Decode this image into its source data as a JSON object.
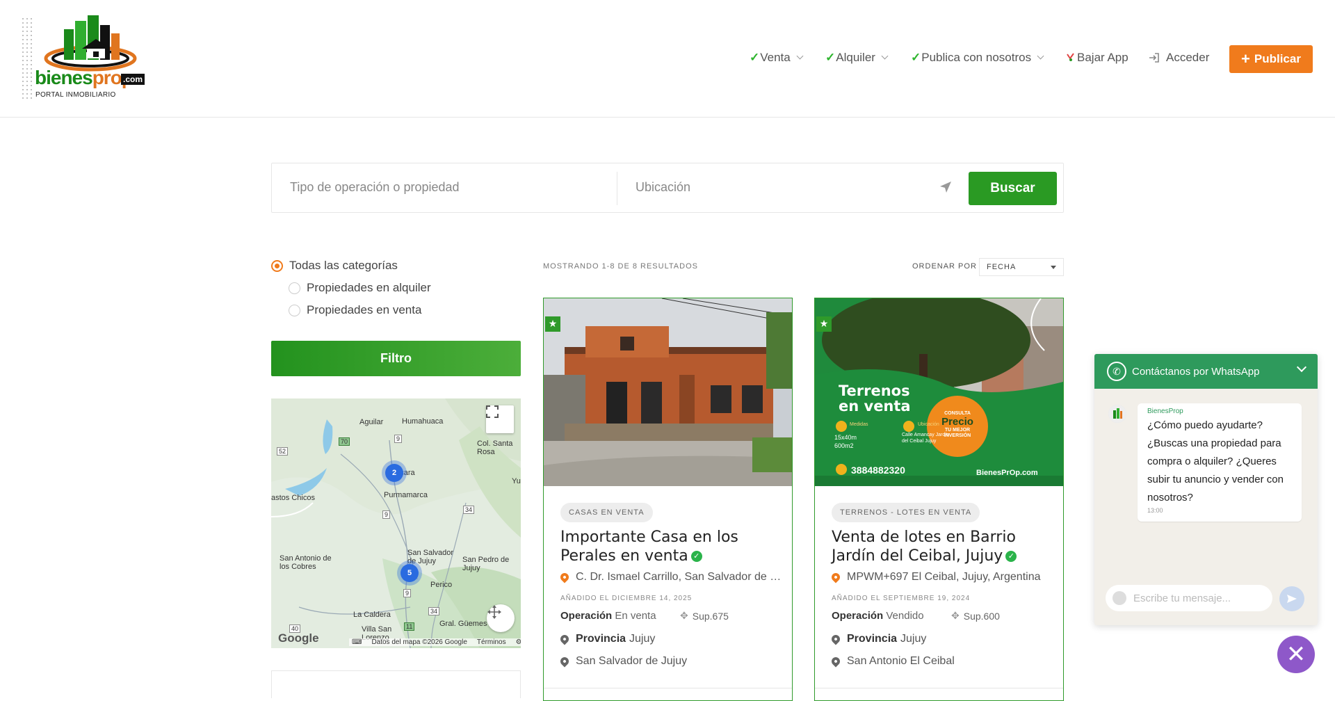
{
  "brand": {
    "name_part1": "bienes",
    "name_part2": "prop",
    "suffix": ".com",
    "tagline": "PORTAL INMOBILIARIO"
  },
  "nav": {
    "items": [
      {
        "label": "Venta",
        "check": "✓",
        "has_dropdown": true
      },
      {
        "label": "Alquiler",
        "check": "✓",
        "has_dropdown": true
      },
      {
        "label": "Publica con nosotros",
        "check": "✓",
        "has_dropdown": true
      },
      {
        "label": "Bajar App",
        "icon": "app-download-icon"
      },
      {
        "label": "Acceder",
        "icon": "login-icon"
      }
    ],
    "publish_label": "Publicar"
  },
  "search": {
    "operation_placeholder": "Tipo de operación o propiedad",
    "location_placeholder": "Ubicación",
    "button_label": "Buscar"
  },
  "filters": {
    "categories": [
      {
        "label": "Todas las categorías",
        "selected": true
      },
      {
        "label": "Propiedades en alquiler",
        "selected": false
      },
      {
        "label": "Propiedades en venta",
        "selected": false
      }
    ],
    "button_label": "Filtro"
  },
  "map": {
    "labels": [
      "Aguilar",
      "Humahuaca",
      "Col. Santa Rosa",
      "Tilcara",
      "Purmamarca",
      "astos Chicos",
      "San Antonio de los Cobres",
      "San Salvador de Jujuy",
      "San Pedro de Jujuy",
      "Perico",
      "La Caldera",
      "Gral. Güemes",
      "Villa San Lorenzo",
      "Yu"
    ],
    "road_numbers": [
      "52",
      "70",
      "9",
      "9",
      "34",
      "9",
      "34",
      "40",
      "11"
    ],
    "clusters": [
      {
        "count": "2"
      },
      {
        "count": "5"
      }
    ],
    "logo": "Google",
    "attribution": "Datos del mapa ©2026 Google",
    "terms": "Términos"
  },
  "results": {
    "summary": "MOSTRANDO 1-8 DE 8 RESULTADOS",
    "sort_label": "ORDENAR POR",
    "sort_value": "FECHA"
  },
  "listings": [
    {
      "category": "CASAS EN VENTA",
      "title": "Importante Casa en los Perales en venta",
      "address": "C. Dr. Ismael Carrillo, San Salvador de Jujuy",
      "added": "AÑADIDO EL DICIEMBRE 14, 2025",
      "operation_label": "Operación",
      "operation_value": "En venta",
      "surface": "Sup.675",
      "province_label": "Provincia",
      "province": "Jujuy",
      "city": "San Salvador de Jujuy"
    },
    {
      "category": "TERRENOS - LOTES EN VENTA",
      "title": "Venta de lotes en Barrio Jardín del Ceibal, Jujuy",
      "address": "MPWM+697 El Ceibal, Jujuy, Argentina",
      "added": "AÑADIDO EL SEPTIEMBRE 19, 2024",
      "operation_label": "Operación",
      "operation_value": "Vendido",
      "surface": "Sup.600",
      "province_label": "Provincia",
      "province": "Jujuy",
      "city": "San Antonio El Ceibal",
      "image_text": {
        "headline1": "Terrenos",
        "headline2": "en venta",
        "measures_label": "Medidas",
        "measures": "15x40m 600m2",
        "location_label": "Ubicación",
        "location": "Calle Amancay Jardín del Ceibal Jujuy",
        "consulta": "CONSULTA",
        "precio": "Precio",
        "inversion": "TU MEJOR INVERSIÓN",
        "phone": "3884882320",
        "brand": "BienesPrOp.com"
      }
    }
  ],
  "whatsapp": {
    "header": "Contáctanos por WhatsApp",
    "sender": "BienesProp",
    "message": "¿Cómo puedo ayudarte? ¿Buscas una propiedad para compra o alquiler? ¿Queres subir tu anuncio y vender con nosotros?",
    "time": "13:00",
    "input_placeholder": "Escribe tu mensaje..."
  },
  "colors": {
    "brand_green": "#2a9a23",
    "brand_orange": "#f07b1c",
    "whatsapp_green": "#2e9a5c",
    "close_purple": "#8e58c9"
  }
}
